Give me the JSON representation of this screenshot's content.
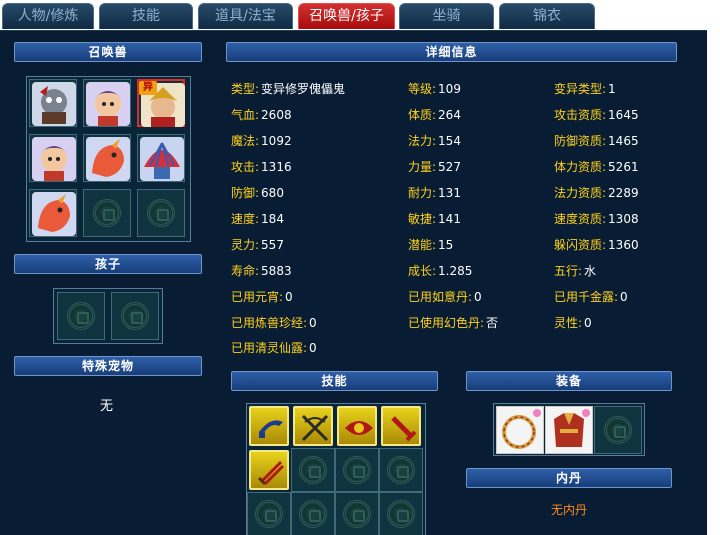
{
  "tabs": [
    {
      "label": "人物/修炼",
      "active": false
    },
    {
      "label": "技能",
      "active": false
    },
    {
      "label": "道具/法宝",
      "active": false
    },
    {
      "label": "召唤兽/孩子",
      "active": true
    },
    {
      "label": "坐骑",
      "active": false
    },
    {
      "label": "锦衣",
      "active": false
    }
  ],
  "left": {
    "summon_title": "召唤兽",
    "child_title": "孩子",
    "special_title": "特殊宠物",
    "special_value": "无",
    "badge_text": "异"
  },
  "details": {
    "title": "详细信息",
    "rows": [
      [
        {
          "k": "类型:",
          "v": "变异修罗傀儡鬼"
        },
        {
          "k": "等级:",
          "v": "109"
        },
        {
          "k": "变异类型:",
          "v": "1"
        }
      ],
      [
        {
          "k": "气血:",
          "v": "2608"
        },
        {
          "k": "体质:",
          "v": "264"
        },
        {
          "k": "攻击资质:",
          "v": "1645"
        }
      ],
      [
        {
          "k": "魔法:",
          "v": "1092"
        },
        {
          "k": "法力:",
          "v": "154"
        },
        {
          "k": "防御资质:",
          "v": "1465"
        }
      ],
      [
        {
          "k": "攻击:",
          "v": "1316"
        },
        {
          "k": "力量:",
          "v": "527"
        },
        {
          "k": "体力资质:",
          "v": "5261"
        }
      ],
      [
        {
          "k": "防御:",
          "v": "680"
        },
        {
          "k": "耐力:",
          "v": "131"
        },
        {
          "k": "法力资质:",
          "v": "2289"
        }
      ],
      [
        {
          "k": "速度:",
          "v": "184"
        },
        {
          "k": "敏捷:",
          "v": "141"
        },
        {
          "k": "速度资质:",
          "v": "1308"
        }
      ],
      [
        {
          "k": "灵力:",
          "v": "557"
        },
        {
          "k": "潜能:",
          "v": "15"
        },
        {
          "k": "躲闪资质:",
          "v": "1360"
        }
      ],
      [
        {
          "k": "寿命:",
          "v": "5883"
        },
        {
          "k": "成长:",
          "v": "1.285"
        },
        {
          "k": "五行:",
          "v": "水"
        }
      ],
      [
        {
          "k": "已用元宵:",
          "v": "0"
        },
        {
          "k": "已用如意丹:",
          "v": "0"
        },
        {
          "k": "已用千金露:",
          "v": "0"
        }
      ],
      [
        {
          "k": "已用炼兽珍经:",
          "v": "0"
        },
        {
          "k": "已使用幻色丹:",
          "v": "否"
        },
        {
          "k": "灵性:",
          "v": "0"
        }
      ],
      [
        {
          "k": "已用清灵仙露:",
          "v": "0"
        }
      ]
    ]
  },
  "skills": {
    "title": "技能"
  },
  "equipment": {
    "title": "装备"
  },
  "neidan": {
    "title": "内丹",
    "value": "无内丹"
  },
  "colors": {
    "label": "#ffd21a",
    "value": "#ffffff",
    "panel": "#081c33",
    "bar": "#2e5fa8",
    "active_tab": "#c81e1e",
    "neidan": "#ff8c1a"
  }
}
